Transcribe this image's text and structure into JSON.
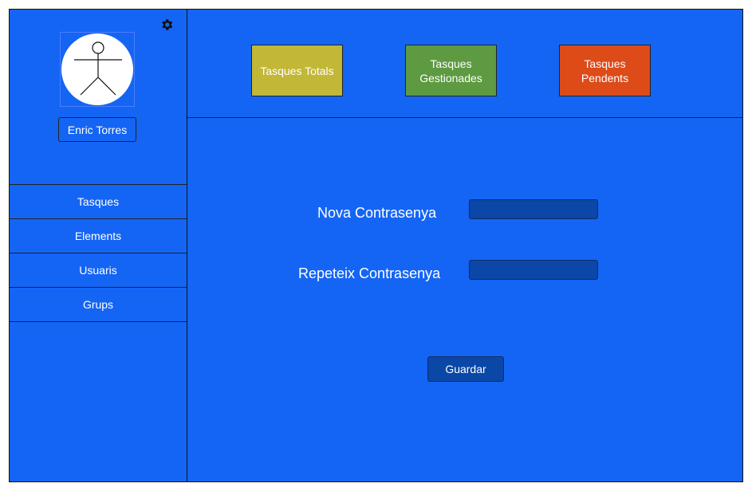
{
  "user": {
    "name": "Enric Torres"
  },
  "sidebar": {
    "items": [
      {
        "label": "Tasques"
      },
      {
        "label": "Elements"
      },
      {
        "label": "Usuaris"
      },
      {
        "label": "Grups"
      }
    ]
  },
  "stats": {
    "total": {
      "label": "Tasques Totals",
      "color": "#c3b737"
    },
    "managed": {
      "label": "Tasques Gestionades",
      "color": "#5e9a41"
    },
    "pending": {
      "label": "Tasques Pendents",
      "color": "#dd4b19"
    }
  },
  "form": {
    "new_password_label": "Nova Contrasenya",
    "repeat_password_label": "Repeteix Contrasenya",
    "new_password_value": "",
    "repeat_password_value": "",
    "save_label": "Guardar"
  },
  "icons": {
    "settings": "gear-icon",
    "avatar": "user-avatar-icon"
  },
  "colors": {
    "background": "#1565f4",
    "field": "#0a47a6"
  }
}
